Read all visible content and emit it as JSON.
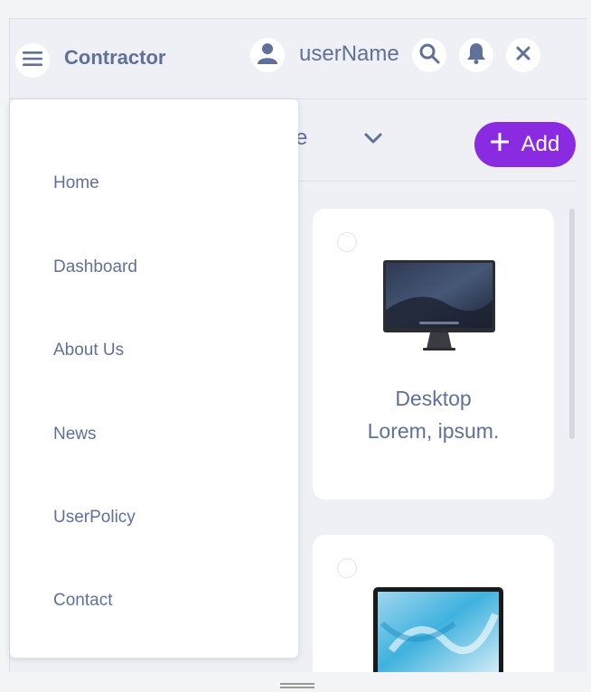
{
  "header": {
    "brand": "Contractor",
    "username": "userName"
  },
  "toolbar": {
    "filter_label": "ctive",
    "add_label": "Add"
  },
  "cards": [
    {
      "title": "Desktop",
      "subtitle": "Lorem, ipsum.",
      "image": "imac-desktop-image"
    },
    {
      "title": "",
      "subtitle": "",
      "image": "macbook-laptop-image"
    }
  ],
  "drawer": {
    "items": [
      {
        "label": "Home"
      },
      {
        "label": "Dashboard"
      },
      {
        "label": "About Us"
      },
      {
        "label": "News"
      },
      {
        "label": "UserPolicy"
      },
      {
        "label": "Contact"
      }
    ]
  },
  "colors": {
    "accent": "#8a2be2",
    "text": "#5f7099",
    "background": "#eef0f5"
  }
}
